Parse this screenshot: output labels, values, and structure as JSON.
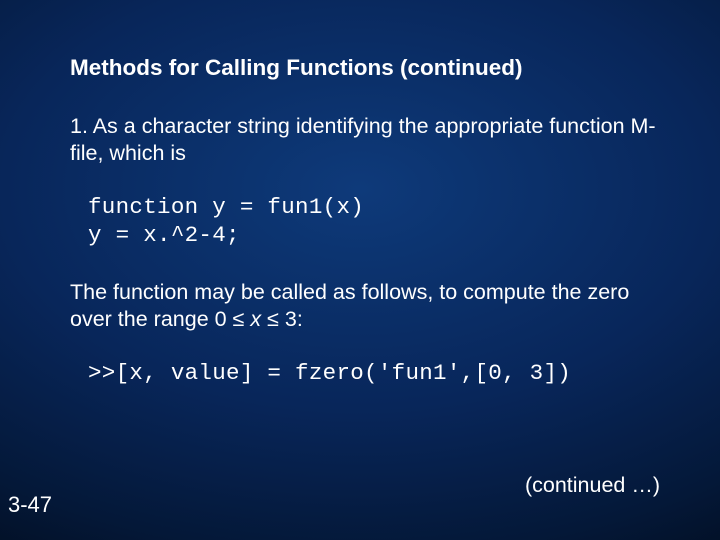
{
  "title": "Methods for Calling Functions (continued)",
  "para1_a": "1.   As a character string identifying the appropriate function M-file, which is",
  "code1": "function y = fun1(x)\ny = x.^2-4;",
  "para2_a": "The function may be called as follows, to compute the zero over the range 0 ",
  "le1": "≤",
  "xvar": " x ",
  "le2": "≤",
  "para2_b": " 3:",
  "code2": ">>[x, value] = fzero('fun1',[0, 3])",
  "continued": "(continued …)",
  "pagenum": "3-47"
}
